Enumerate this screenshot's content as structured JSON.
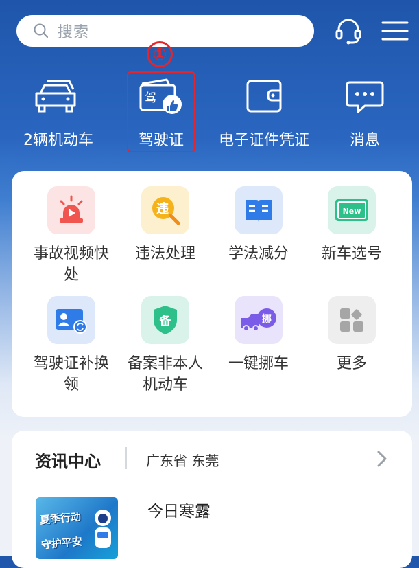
{
  "search": {
    "placeholder": "搜索"
  },
  "header": {
    "support_icon": "headset-icon",
    "menu_icon": "menu-icon"
  },
  "quick_actions": [
    {
      "label": "2辆机动车",
      "icon": "cars-icon"
    },
    {
      "label": "驾驶证",
      "icon": "license-icon",
      "icon_text": "驾"
    },
    {
      "label": "电子证件凭证",
      "icon": "wallet-icon"
    },
    {
      "label": "消息",
      "icon": "message-icon"
    }
  ],
  "annotation": {
    "marker": "①",
    "color": "#e5252b"
  },
  "services": [
    {
      "label": "事故视频快处",
      "icon": "siren-icon",
      "tile_color": "#fde4e4"
    },
    {
      "label": "违法处理",
      "icon": "violation-search-icon",
      "icon_text": "违",
      "tile_color": "#fdf0cf"
    },
    {
      "label": "学法减分",
      "icon": "book-icon",
      "tile_color": "#dde9fb"
    },
    {
      "label": "新车选号",
      "icon": "new-plate-icon",
      "icon_text": "New",
      "tile_color": "#daf3ea"
    },
    {
      "label": "驾驶证补换领",
      "icon": "license-renew-icon",
      "tile_color": "#dde9fb"
    },
    {
      "label": "备案非本人机动车",
      "icon": "record-shield-icon",
      "icon_text": "备",
      "tile_color": "#daf3ea"
    },
    {
      "label": "一键挪车",
      "icon": "move-car-icon",
      "icon_text": "挪",
      "tile_color": "#e9e4fb"
    },
    {
      "label": "更多",
      "icon": "more-grid-icon",
      "tile_color": "#eeeeee"
    }
  ],
  "news": {
    "section_title": "资讯中心",
    "location": "广东省 东莞",
    "headline": "今日寒露",
    "thumbnail_text_1": "夏季行动",
    "thumbnail_text_2": "守护平安"
  },
  "colors": {
    "brand_blue": "#2a66c0",
    "highlight_red": "#e5252b"
  }
}
